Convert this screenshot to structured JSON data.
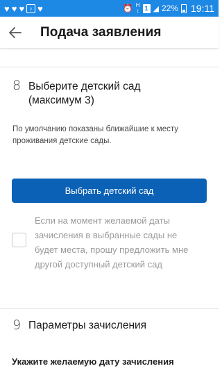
{
  "status_bar": {
    "battery": "22%",
    "time": "19:11",
    "network_label": "H",
    "sim_number": "1",
    "color": "#1e88e5"
  },
  "header": {
    "back_icon": "arrow-left-icon",
    "title": "Подача заявления"
  },
  "step8": {
    "number": "8",
    "title_line1": "Выберите детский сад",
    "title_line2": "(максимум 3)",
    "description": "По умолчанию показаны ближайшие к месту проживания детские сады.",
    "button_label": "Выбрать детский сад",
    "button_color": "#0b61b5",
    "checkbox_checked": false,
    "checkbox_label": "Если на момент желаемой даты зачисления в выбранные сады не будет места, прошу предложить мне другой доступный детский сад"
  },
  "step9": {
    "number": "9",
    "title": "Параметры зачисления",
    "field_label": "Укажите желаемую дату зачисления"
  }
}
